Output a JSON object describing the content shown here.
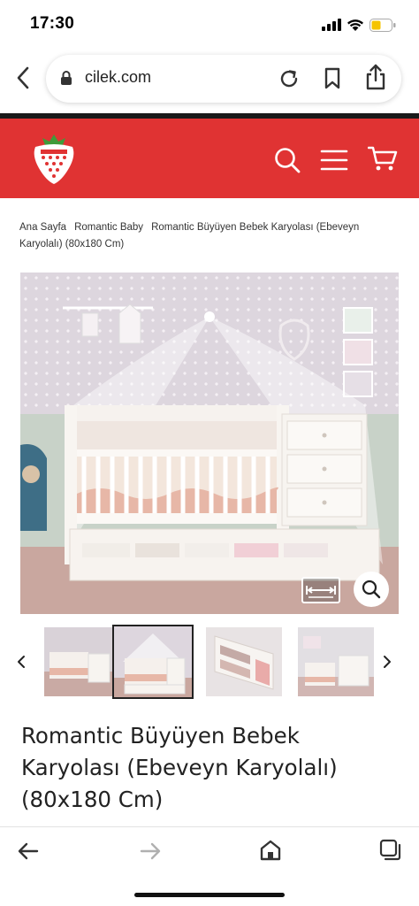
{
  "status_bar": {
    "time": "17:30"
  },
  "browser": {
    "url": "cilek.com"
  },
  "breadcrumb": {
    "items": [
      "Ana Sayfa",
      "Romantic Baby",
      "Romantic Büyüyen Bebek Karyolası (Ebeveyn Karyolalı) (80x180 Cm)"
    ]
  },
  "product": {
    "title": "Romantic Büyüyen Bebek Karyolası (Ebeveyn Karyolalı) (80x180 Cm)",
    "thumbnail_count": 4,
    "active_thumbnail": 2
  },
  "colors": {
    "brand": "#e03333",
    "header_divider": "#1a1a1a"
  },
  "icons": {
    "logo": "strawberry-logo-icon",
    "search": "search-icon",
    "menu": "hamburger-menu-icon",
    "cart": "cart-icon",
    "zoom": "zoom-icon",
    "measure": "measure-icon"
  }
}
